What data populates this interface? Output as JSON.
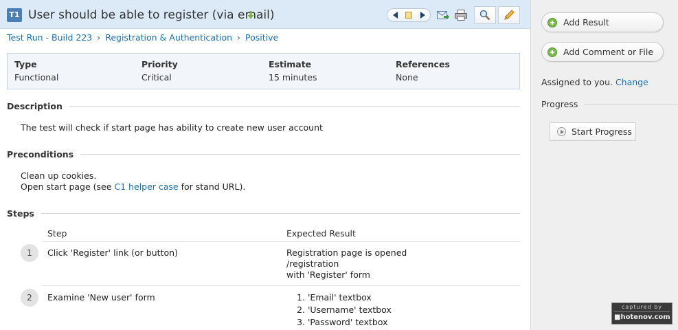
{
  "header": {
    "case_id": "T1",
    "title": "User should be able to register (via email)"
  },
  "breadcrumb": [
    {
      "label": "Test Run - Build 223"
    },
    {
      "label": "Registration & Authentication"
    },
    {
      "label": "Positive"
    }
  ],
  "breadcrumb_separator": "›",
  "info": {
    "type_label": "Type",
    "type_value": "Functional",
    "priority_label": "Priority",
    "priority_value": "Critical",
    "estimate_label": "Estimate",
    "estimate_value": "15 minutes",
    "references_label": "References",
    "references_value": "None"
  },
  "description": {
    "heading": "Description",
    "text": "The test will check if start page has ability to create new user account"
  },
  "preconditions": {
    "heading": "Preconditions",
    "line1": "Clean up cookies.",
    "line2_pre": "Open start page (see ",
    "line2_link": "C1 helper case",
    "line2_post": " for stand URL)."
  },
  "steps": {
    "heading": "Steps",
    "col_step": "Step",
    "col_expected": "Expected Result",
    "rows": [
      {
        "num": "1",
        "step": "Click 'Register' link (or button)",
        "expected_lines": [
          "Registration page is opened",
          "/registration",
          "with 'Register' form"
        ]
      },
      {
        "num": "2",
        "step": "Examine 'New user' form",
        "expected_list": [
          "'Email' textbox",
          "'Username' textbox",
          "'Password' textbox"
        ]
      }
    ]
  },
  "sidebar": {
    "add_result": "Add Result",
    "add_comment": "Add Comment or File",
    "assigned_text": "Assigned to you.",
    "change_link": "Change",
    "progress_heading": "Progress",
    "start_progress": "Start Progress"
  },
  "watermark": {
    "line1": "captured by",
    "line2": "■hotenov.com"
  },
  "colors": {
    "header_bg": "#dce9f7",
    "link": "#1a6fb0",
    "case_badge": "#4a7fb5",
    "add_icon": "#79b94a"
  }
}
